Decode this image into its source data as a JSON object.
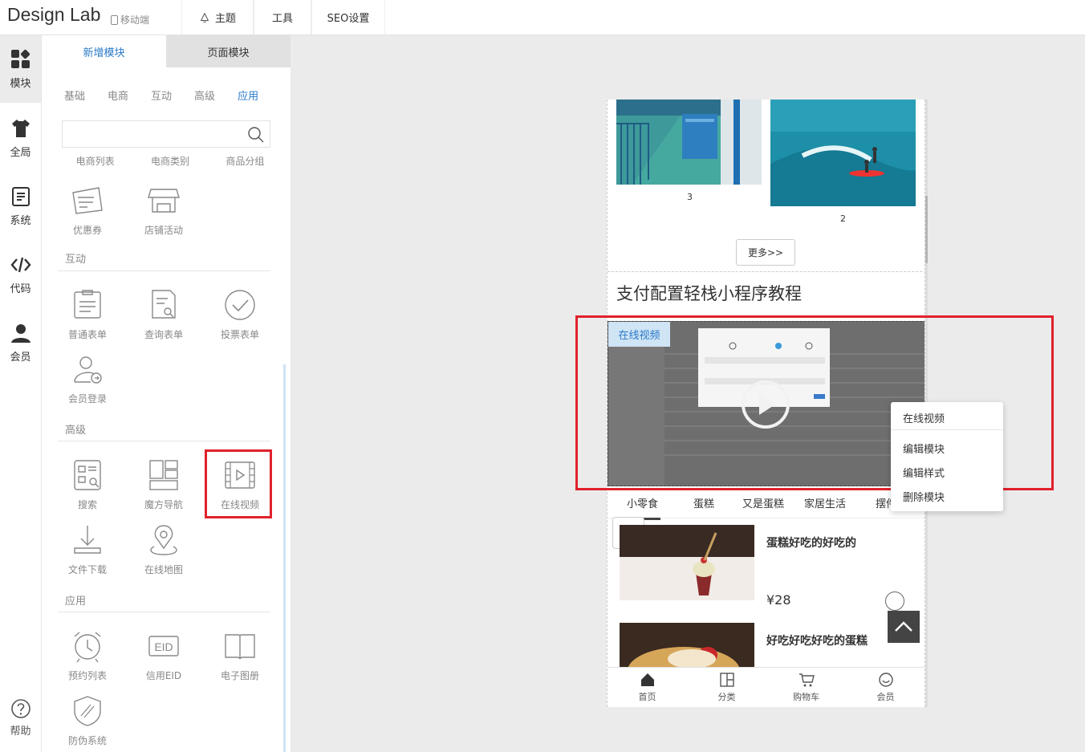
{
  "app": {
    "brand": "Design Lab",
    "mobile_label": "移动端"
  },
  "topnav": {
    "theme": "主题",
    "tools": "工具",
    "seo": "SEO设置"
  },
  "rail": {
    "modules": "模块",
    "global": "全局",
    "system": "系统",
    "code": "代码",
    "member": "会员",
    "help": "帮助"
  },
  "panel": {
    "tab_add": "新增模块",
    "tab_page": "页面模块",
    "categories": [
      "基础",
      "电商",
      "互动",
      "高级",
      "应用"
    ],
    "selected_category": "应用",
    "search_placeholder": "",
    "ecom_labels": [
      "电商列表",
      "电商类别",
      "商品分组"
    ],
    "ecom_items": [
      "优惠券",
      "店铺活动"
    ],
    "section_interact": "互动",
    "interact_items": [
      "普通表单",
      "查询表单",
      "投票表单",
      "会员登录"
    ],
    "section_advanced": "高级",
    "advanced_items": [
      "搜索",
      "魔方导航",
      "在线视频",
      "文件下载",
      "在线地图"
    ],
    "section_app": "应用",
    "app_items": [
      "预约列表",
      "信用EID",
      "电子图册",
      "防伪系统"
    ]
  },
  "preview": {
    "cap1": "3",
    "cap2": "2",
    "more_button": "更多>>",
    "section_title": "支付配置轻栈小程序教程",
    "video_tag": "在线视频",
    "tabs": [
      "小零食",
      "蛋糕",
      "又是蛋糕",
      "家居生活",
      "摆件"
    ],
    "product1_name": "蛋糕好吃的好吃的",
    "product1_price": "¥28",
    "product2_name": "好吃好吃好吃的蛋糕",
    "bottom_nav": [
      "首页",
      "分类",
      "购物车",
      "会员"
    ]
  },
  "context_menu": {
    "title": "在线视频",
    "edit_module": "编辑模块",
    "edit_style": "编辑样式",
    "delete_module": "删除模块"
  },
  "colors": {
    "accent": "#2a7ac9",
    "highlight": "#e0212b"
  }
}
